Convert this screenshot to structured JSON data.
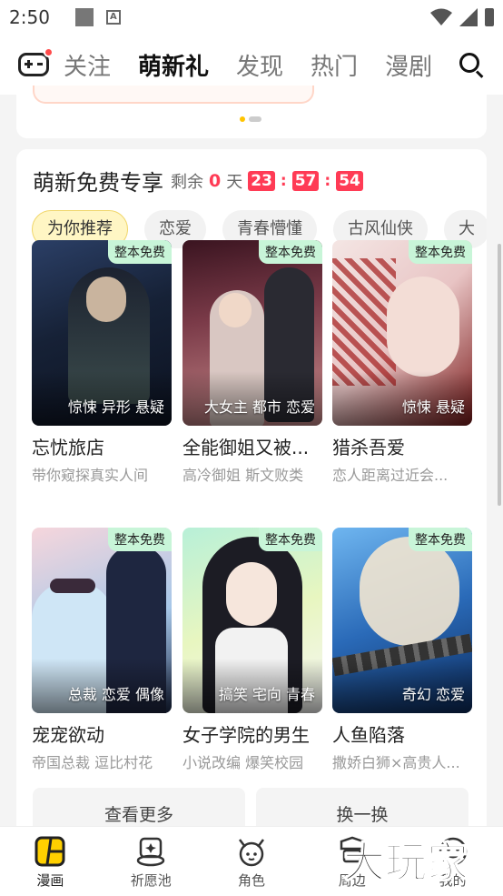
{
  "status_bar": {
    "time": "2:50",
    "a_icon": "A"
  },
  "top_nav": {
    "tabs": [
      "关注",
      "萌新礼",
      "发现",
      "热门",
      "漫剧"
    ],
    "active_tab": "萌新礼"
  },
  "section": {
    "title": "萌新免费专享",
    "remain_label": "剩余",
    "days": "0",
    "day_unit": "天",
    "hours": "23",
    "minutes": "57",
    "seconds": "54",
    "colon": ":"
  },
  "chips": [
    "为你推荐",
    "恋爱",
    "青春懵懂",
    "古风仙侠",
    "大"
  ],
  "badge_text": "整本免费",
  "comics": [
    {
      "title": "忘忧旅店",
      "subtitle": "带你窥探真实人间",
      "tags": "惊悚 异形 悬疑"
    },
    {
      "title": "全能御姐又被...",
      "subtitle": "高冷御姐 斯文败类",
      "tags": "大女主 都市 恋爱"
    },
    {
      "title": "猎杀吾爱",
      "subtitle": "恋人距离过近会...",
      "tags": "惊悚 悬疑"
    },
    {
      "title": "宠宠欲动",
      "subtitle": "帝国总裁 逗比村花",
      "tags": "总裁 恋爱 偶像"
    },
    {
      "title": "女子学院的男生",
      "subtitle": "小说改编 爆笑校园",
      "tags": "搞笑 宅向 青春"
    },
    {
      "title": "人鱼陷落",
      "subtitle": "撒娇白狮×高贵人...",
      "tags": "奇幻 恋爱"
    }
  ],
  "buttons": {
    "more": "查看更多",
    "refresh": "换一换"
  },
  "bottom_nav": [
    "漫画",
    "祈愿池",
    "角色",
    "周边",
    "我的"
  ],
  "colors": {
    "accent_red": "#ff3b55",
    "active_yellow": "#ffc400",
    "badge_green": "#c8f5d8"
  },
  "icons": {
    "game": "gamepad-icon",
    "search": "search-icon",
    "nav": [
      "comic-icon",
      "wish-pool-icon",
      "character-icon",
      "merch-icon",
      "profile-icon"
    ]
  },
  "watermark": "大玩家"
}
